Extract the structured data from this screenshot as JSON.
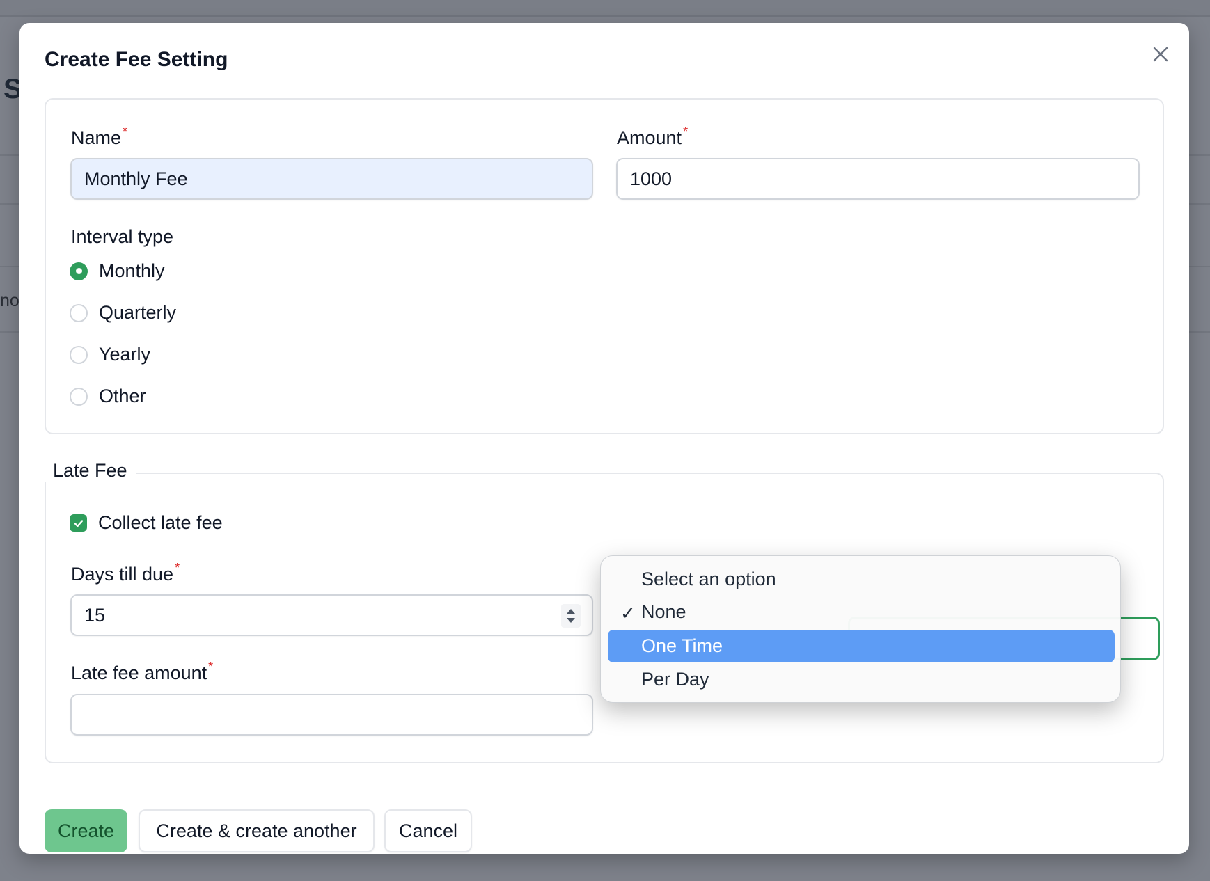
{
  "background": {
    "fragment_1": "S",
    "fragment_2": "nov"
  },
  "modal": {
    "title": "Create Fee Setting",
    "close_icon": "close-icon"
  },
  "form": {
    "name": {
      "label": "Name",
      "required_mark": "*",
      "value": "Monthly Fee"
    },
    "amount": {
      "label": "Amount",
      "required_mark": "*",
      "value": "1000"
    },
    "interval_type": {
      "label": "Interval type",
      "options": [
        {
          "label": "Monthly",
          "checked": true
        },
        {
          "label": "Quarterly",
          "checked": false
        },
        {
          "label": "Yearly",
          "checked": false
        },
        {
          "label": "Other",
          "checked": false
        }
      ]
    },
    "late_fee": {
      "legend": "Late Fee",
      "collect_label": "Collect late fee",
      "collect_checked": true,
      "days_till_due": {
        "label": "Days till due",
        "required_mark": "*",
        "value": "15"
      },
      "late_fee_amount": {
        "label": "Late fee amount",
        "required_mark": "*",
        "value": ""
      },
      "late_fee_type_dropdown": {
        "options": [
          {
            "label": "Select an option",
            "selected": false,
            "highlighted": false
          },
          {
            "label": "None",
            "selected": true,
            "highlighted": false
          },
          {
            "label": "One Time",
            "selected": false,
            "highlighted": true
          },
          {
            "label": "Per Day",
            "selected": false,
            "highlighted": false
          }
        ],
        "check_mark": "✓"
      }
    }
  },
  "actions": {
    "create": "Create",
    "create_another": "Create & create another",
    "cancel": "Cancel"
  },
  "colors": {
    "accent_green": "#2e9d5b",
    "primary_button": "#6ec68e",
    "highlight_blue": "#5d9cf5",
    "required_red": "#dc2626"
  }
}
